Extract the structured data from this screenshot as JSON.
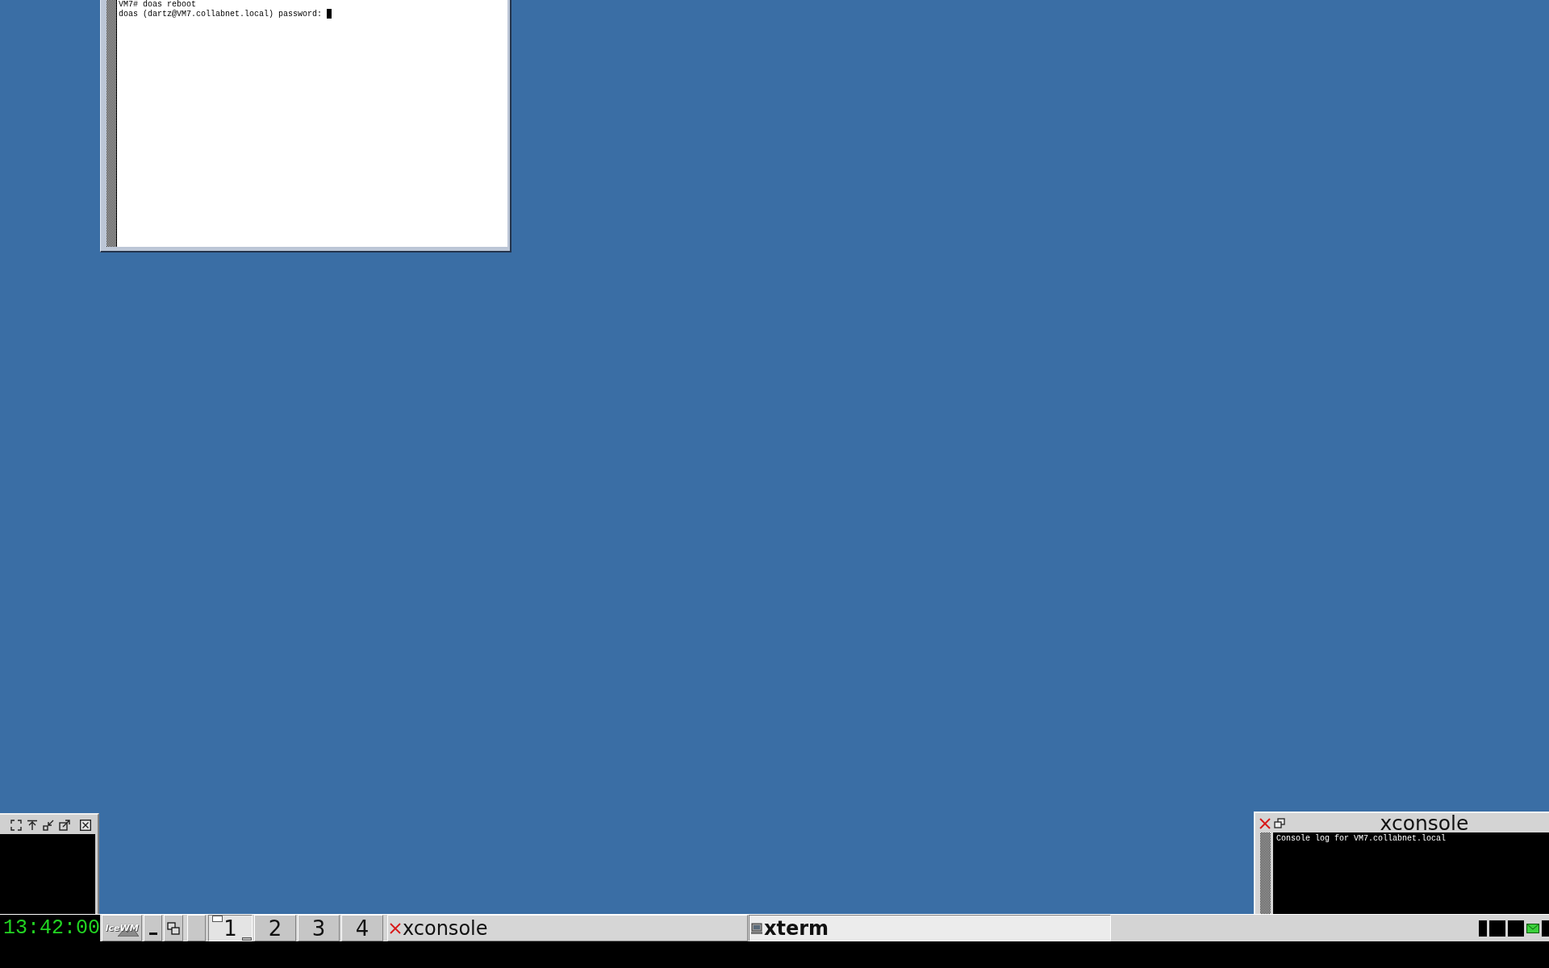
{
  "terminal": {
    "lines": [
      "VM7# doas reboot",
      "doas (dartz@VM7.collabnet.local) password:"
    ]
  },
  "console_window": {
    "title": "xconsole",
    "log_lines": [
      "Console log for VM7.collabnet.local"
    ]
  },
  "taskbar": {
    "clock": "13:42:00",
    "start_button": {
      "label": "IceWM"
    },
    "workspaces": [
      {
        "label": "1",
        "selected": true,
        "preview": true
      },
      {
        "label": "2",
        "selected": false,
        "preview": false
      },
      {
        "label": "3",
        "selected": false,
        "preview": false
      },
      {
        "label": "4",
        "selected": false,
        "preview": false
      }
    ],
    "tasks": [
      {
        "label": "xconsole",
        "kind": "console",
        "selected": false
      },
      {
        "label": "xterm",
        "kind": "terminal",
        "selected": true
      }
    ]
  }
}
